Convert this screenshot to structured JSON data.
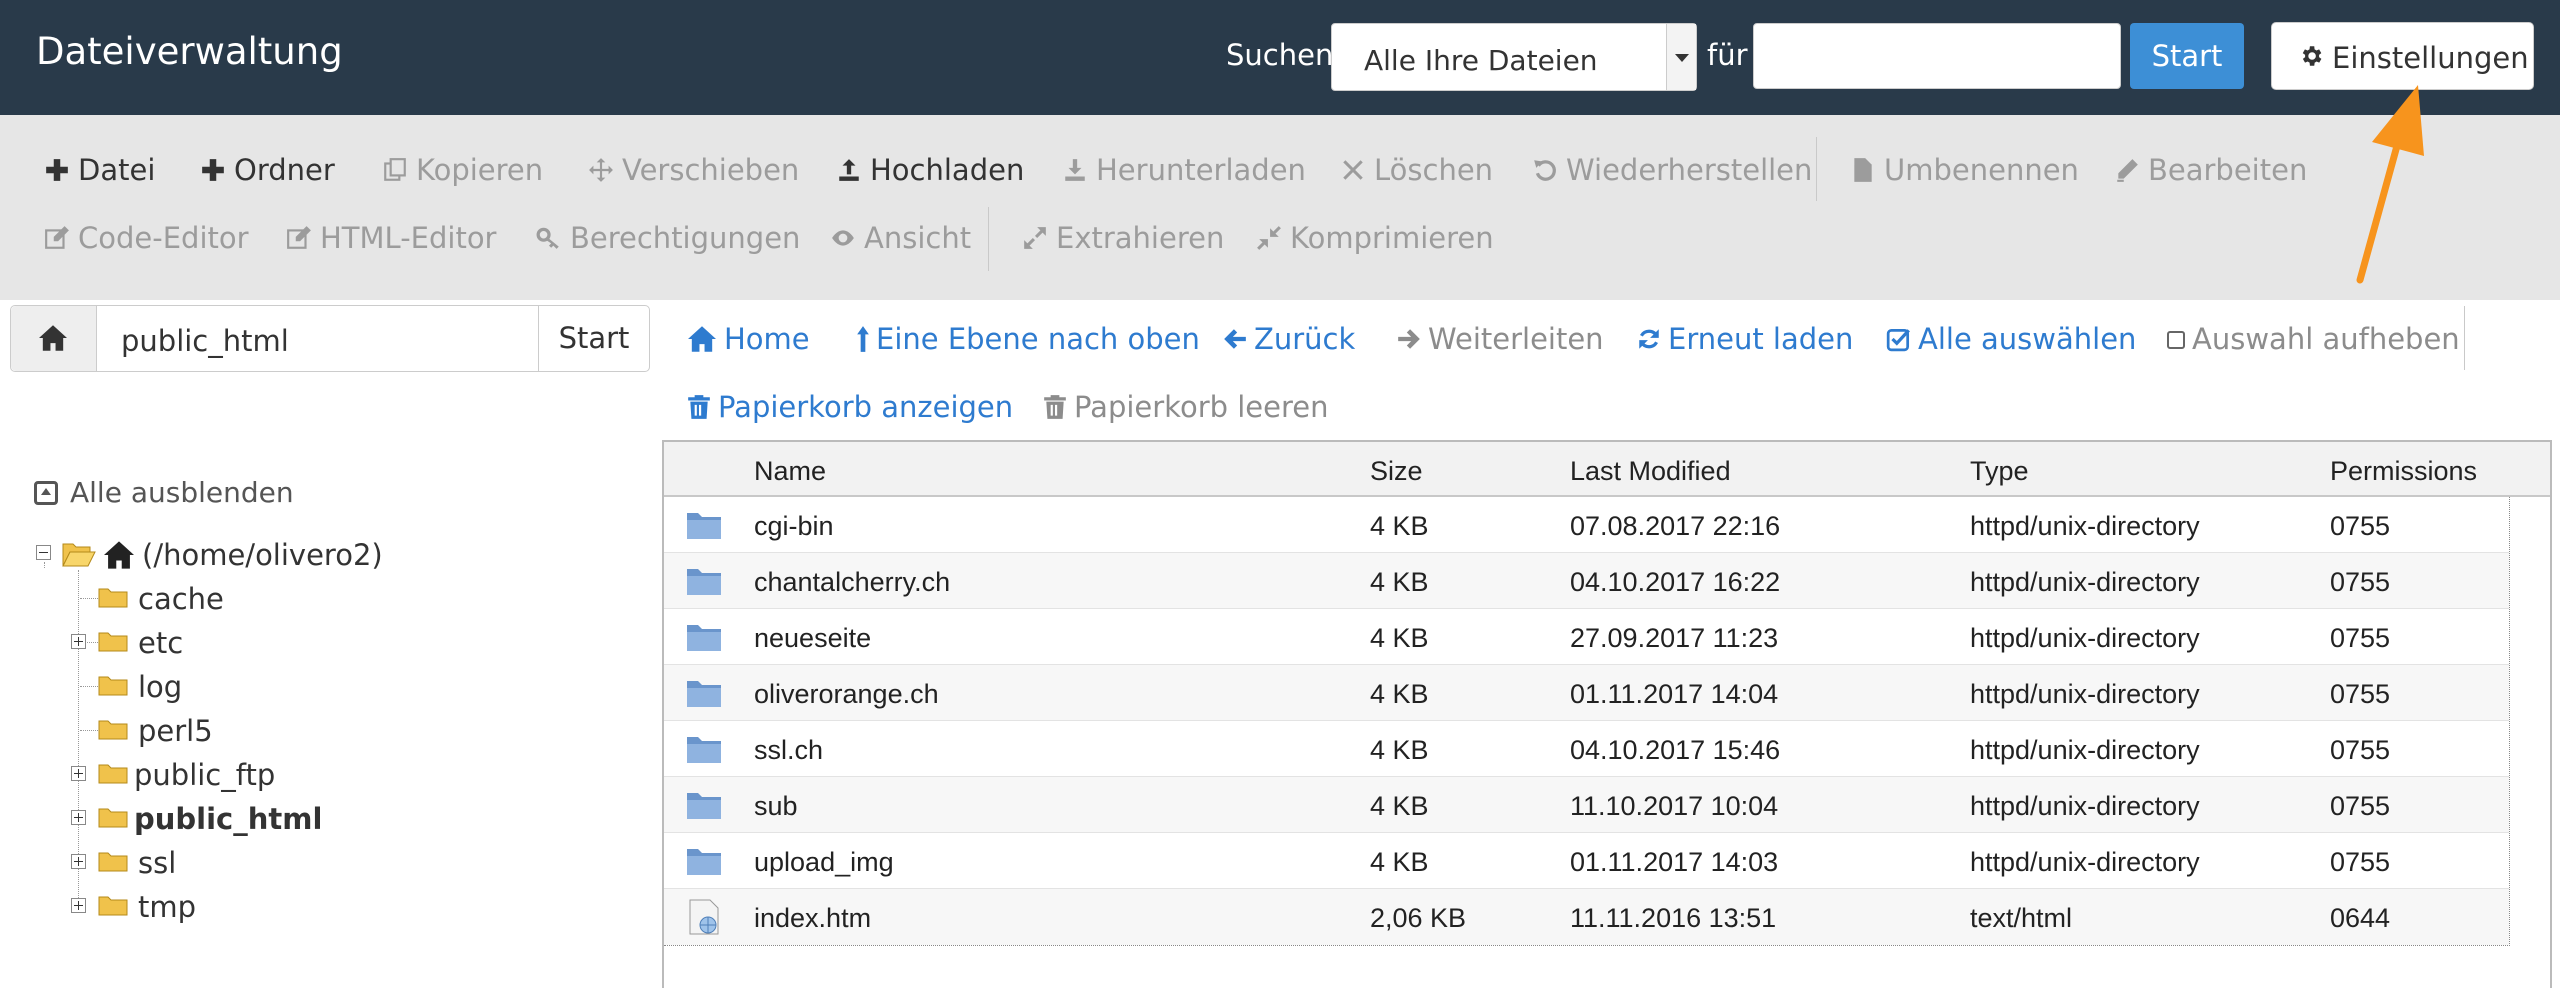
{
  "header": {
    "title": "Dateiverwaltung",
    "search_label": "Suchen",
    "search_scope": "Alle Ihre Dateien",
    "for_label": "für",
    "search_value": "",
    "search_button": "Start",
    "settings_button": "Einstellungen"
  },
  "toolbar": {
    "row1": [
      {
        "label": "Datei",
        "icon": "plus-icon",
        "enabled": true
      },
      {
        "label": "Ordner",
        "icon": "plus-icon",
        "enabled": true
      },
      {
        "label": "Kopieren",
        "icon": "copy-icon",
        "enabled": false
      },
      {
        "label": "Verschieben",
        "icon": "move-icon",
        "enabled": false
      },
      {
        "label": "Hochladen",
        "icon": "upload-icon",
        "enabled": true
      },
      {
        "label": "Herunterladen",
        "icon": "download-icon",
        "enabled": false
      },
      {
        "label": "Löschen",
        "icon": "times-icon",
        "enabled": false
      },
      {
        "label": "Wiederherstellen",
        "icon": "undo-icon",
        "enabled": false
      },
      {
        "label": "Umbenennen",
        "icon": "file-icon",
        "enabled": false
      },
      {
        "label": "Bearbeiten",
        "icon": "pencil-icon",
        "enabled": false
      }
    ],
    "row2": [
      {
        "label": "Code-Editor",
        "icon": "edit-icon",
        "enabled": false
      },
      {
        "label": "HTML-Editor",
        "icon": "edit-icon",
        "enabled": false
      },
      {
        "label": "Berechtigungen",
        "icon": "key-icon",
        "enabled": false
      },
      {
        "label": "Ansicht",
        "icon": "eye-icon",
        "enabled": false
      },
      {
        "label": "Extrahieren",
        "icon": "expand-icon",
        "enabled": false
      },
      {
        "label": "Komprimieren",
        "icon": "compress-icon",
        "enabled": false
      }
    ]
  },
  "pathbar": {
    "value": "public_html",
    "go_label": "Start"
  },
  "nav": {
    "row1": [
      {
        "label": "Home",
        "icon": "home-icon",
        "enabled": true
      },
      {
        "label": "Eine Ebene nach oben",
        "icon": "level-up-icon",
        "enabled": true
      },
      {
        "label": "Zurück",
        "icon": "arrow-left-icon",
        "enabled": true
      },
      {
        "label": "Weiterleiten",
        "icon": "arrow-right-icon",
        "enabled": false
      },
      {
        "label": "Erneut laden",
        "icon": "refresh-icon",
        "enabled": true
      },
      {
        "label": "Alle auswählen",
        "icon": "check-square-icon",
        "enabled": true
      },
      {
        "label": "Auswahl aufheben",
        "icon": "square-icon",
        "enabled": false
      }
    ],
    "row2": [
      {
        "label": "Papierkorb anzeigen",
        "icon": "trash-icon",
        "enabled": true
      },
      {
        "label": "Papierkorb leeren",
        "icon": "trash-icon",
        "enabled": false
      }
    ]
  },
  "tree": {
    "collapse_all": "Alle ausblenden",
    "root": "(/home/olivero2)",
    "items": [
      {
        "label": "cache",
        "expandable": false,
        "selected": false
      },
      {
        "label": "etc",
        "expandable": true,
        "selected": false
      },
      {
        "label": "log",
        "expandable": false,
        "selected": false
      },
      {
        "label": "perl5",
        "expandable": false,
        "selected": false
      },
      {
        "label": "public_ftp",
        "expandable": true,
        "selected": false
      },
      {
        "label": "public_html",
        "expandable": true,
        "selected": true
      },
      {
        "label": "ssl",
        "expandable": true,
        "selected": false
      },
      {
        "label": "tmp",
        "expandable": true,
        "selected": false
      }
    ]
  },
  "table": {
    "columns": [
      "Name",
      "Size",
      "Last Modified",
      "Type",
      "Permissions"
    ],
    "rows": [
      {
        "icon": "folder-icon",
        "name": "cgi-bin",
        "size": "4 KB",
        "modified": "07.08.2017 22:16",
        "type": "httpd/unix-directory",
        "perms": "0755"
      },
      {
        "icon": "folder-icon",
        "name": "chantalcherry.ch",
        "size": "4 KB",
        "modified": "04.10.2017 16:22",
        "type": "httpd/unix-directory",
        "perms": "0755"
      },
      {
        "icon": "folder-icon",
        "name": "neueseite",
        "size": "4 KB",
        "modified": "27.09.2017 11:23",
        "type": "httpd/unix-directory",
        "perms": "0755"
      },
      {
        "icon": "folder-icon",
        "name": "oliverorange.ch",
        "size": "4 KB",
        "modified": "01.11.2017 14:04",
        "type": "httpd/unix-directory",
        "perms": "0755"
      },
      {
        "icon": "folder-icon",
        "name": "ssl.ch",
        "size": "4 KB",
        "modified": "04.10.2017 15:46",
        "type": "httpd/unix-directory",
        "perms": "0755"
      },
      {
        "icon": "folder-icon",
        "name": "sub",
        "size": "4 KB",
        "modified": "11.10.2017 10:04",
        "type": "httpd/unix-directory",
        "perms": "0755"
      },
      {
        "icon": "folder-icon",
        "name": "upload_img",
        "size": "4 KB",
        "modified": "01.11.2017 14:03",
        "type": "httpd/unix-directory",
        "perms": "0755"
      },
      {
        "icon": "html-file-icon",
        "name": "index.htm",
        "size": "2,06 KB",
        "modified": "11.11.2016 13:51",
        "type": "text/html",
        "perms": "0644"
      }
    ]
  },
  "colors": {
    "header_bg": "#293a4a",
    "toolbar_bg": "#e6e6e6",
    "link_blue": "#2e7bcf",
    "primary_button": "#3d8fd6",
    "annotation_arrow": "#f7941d"
  }
}
